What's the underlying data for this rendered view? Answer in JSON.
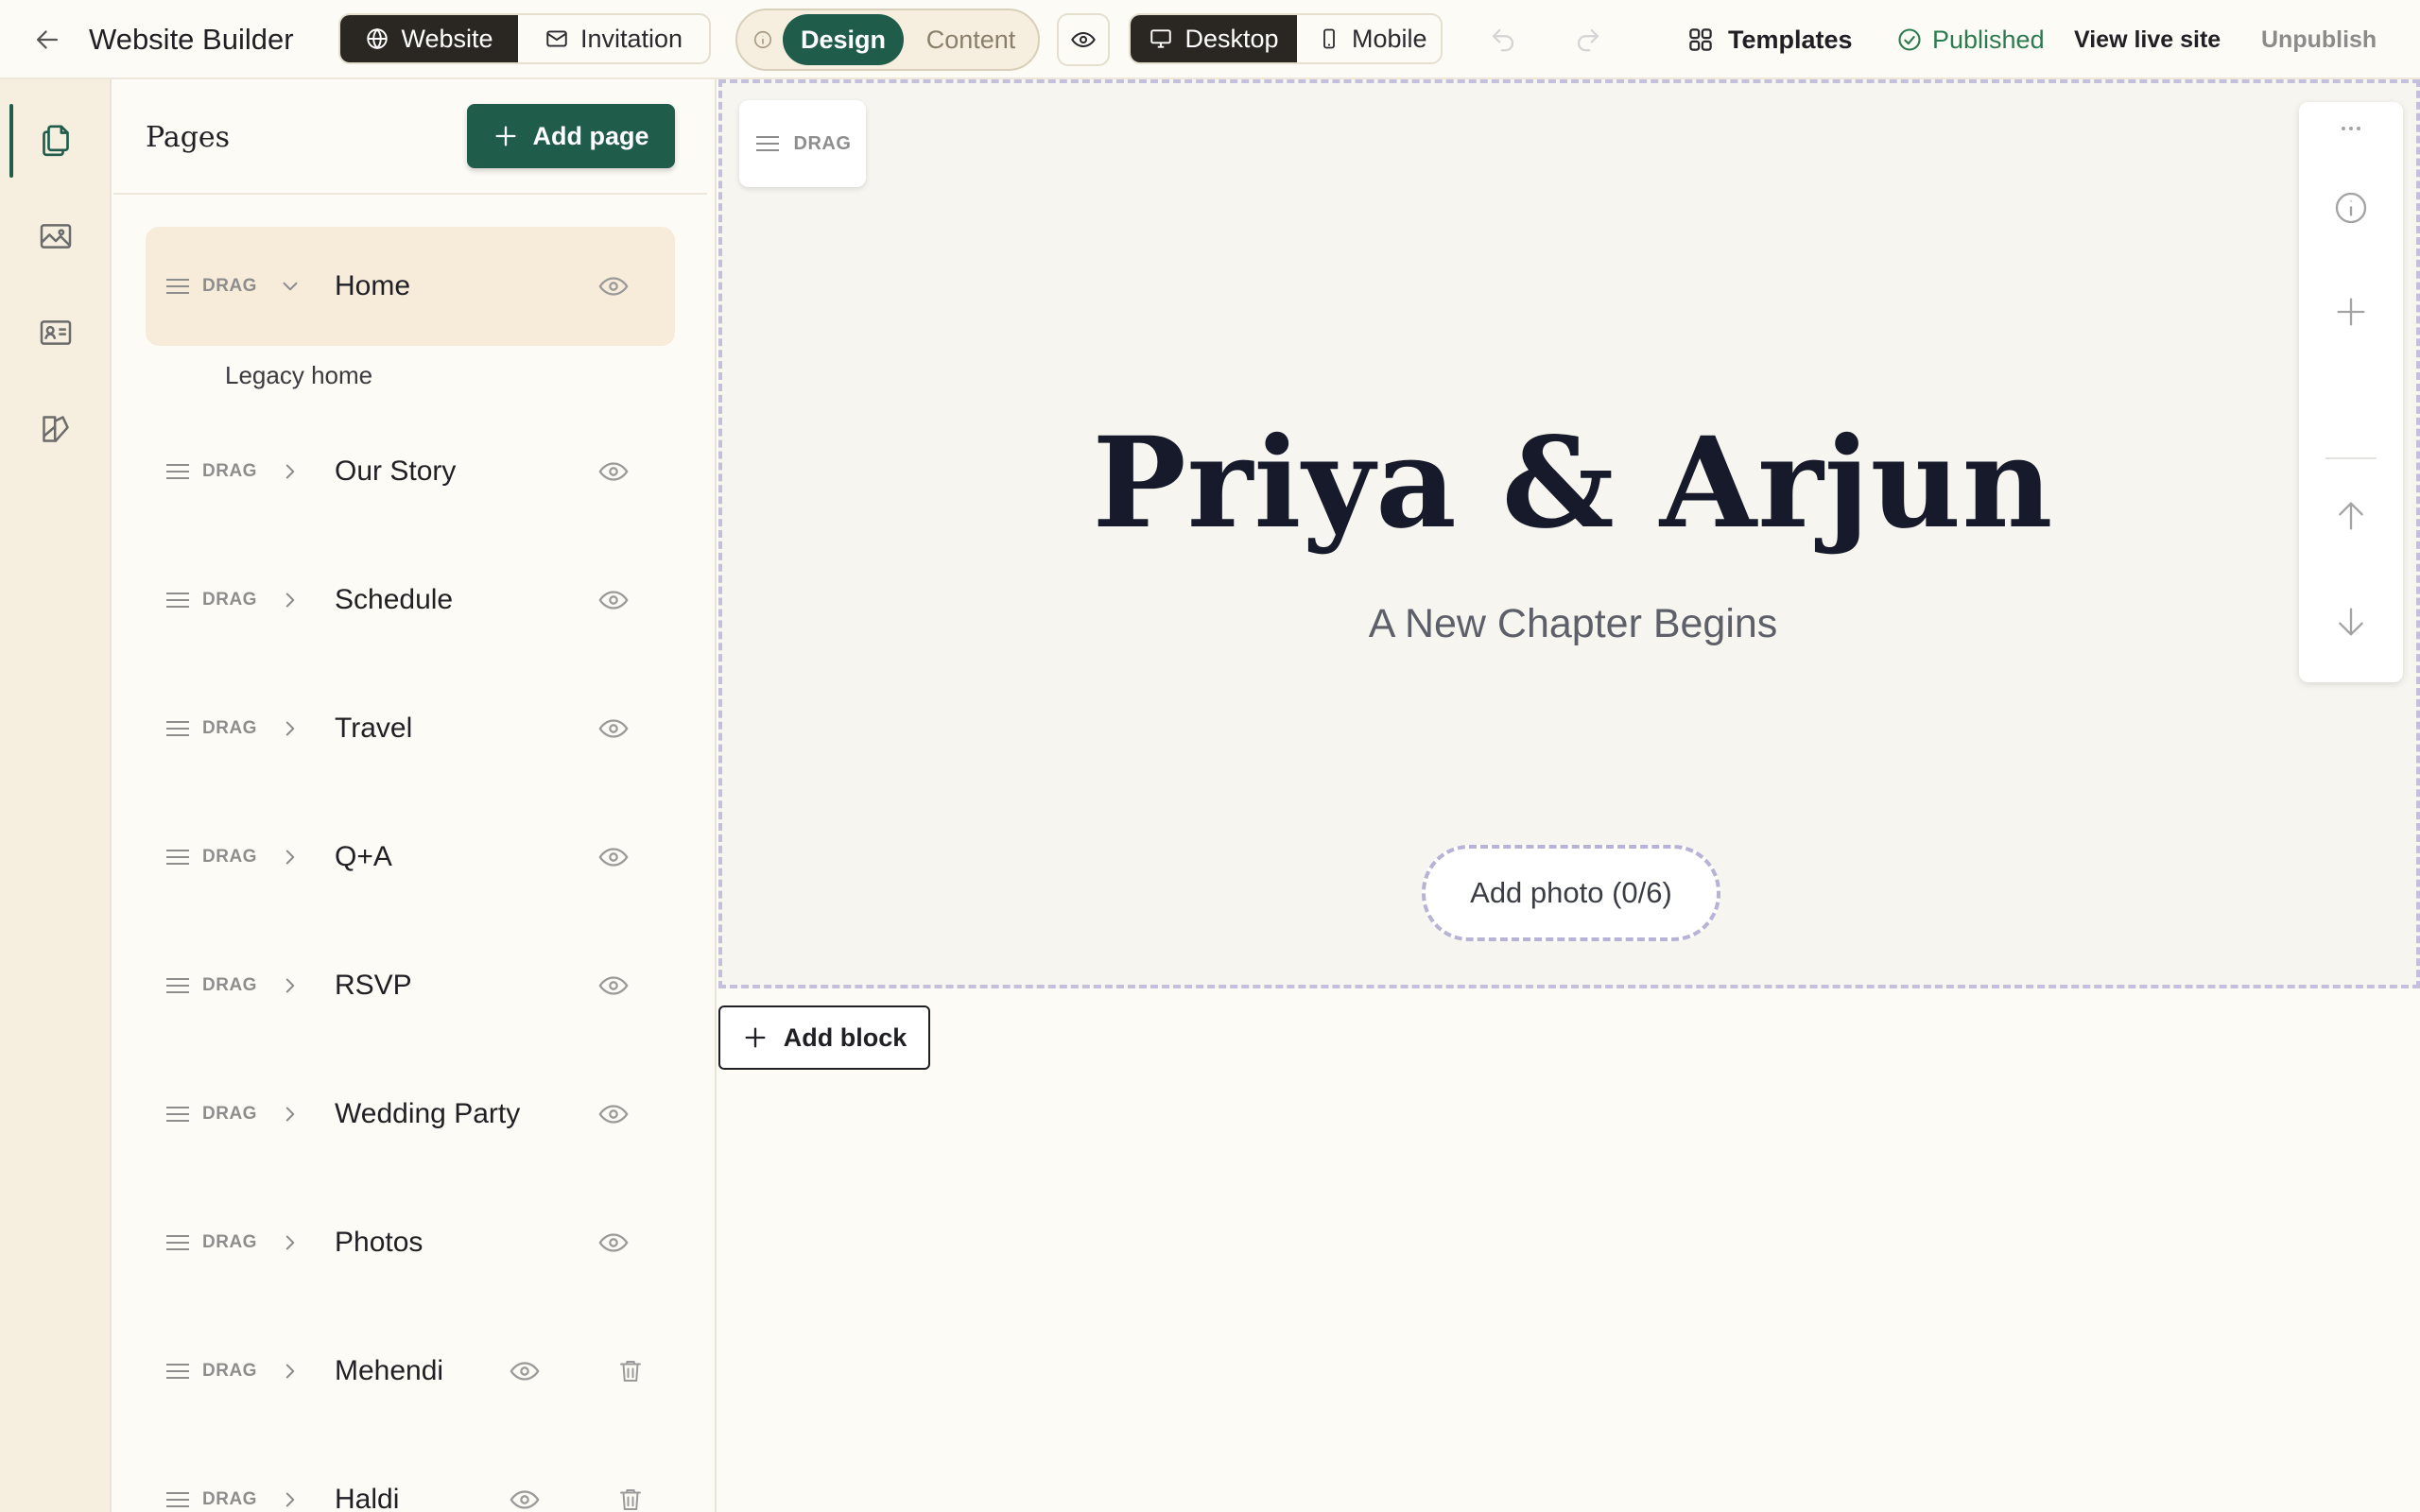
{
  "header": {
    "title": "Website Builder",
    "tabs": [
      {
        "label": "Website",
        "icon": "globe-icon",
        "active": true
      },
      {
        "label": "Invitation",
        "icon": "mail-icon",
        "active": false
      }
    ],
    "mode": {
      "options": [
        {
          "label": "Design",
          "active": true
        },
        {
          "label": "Content",
          "active": false
        }
      ]
    },
    "device": {
      "options": [
        {
          "label": "Desktop",
          "icon": "desktop-icon",
          "active": true
        },
        {
          "label": "Mobile",
          "icon": "mobile-icon",
          "active": false
        }
      ]
    },
    "templates_label": "Templates",
    "status_label": "Published",
    "live_site_label": "View live site",
    "unpublish_label": "Unpublish"
  },
  "rail": {
    "items": [
      {
        "icon": "pages-icon",
        "active": true
      },
      {
        "icon": "image-icon",
        "active": false
      },
      {
        "icon": "contact-card-icon",
        "active": false
      },
      {
        "icon": "theme-icon",
        "active": false
      }
    ]
  },
  "pages_panel": {
    "title": "Pages",
    "add_label": "Add page",
    "drag_label": "DRAG",
    "legacy_label": "Legacy home",
    "pages": [
      {
        "name": "Home",
        "expanded": true,
        "selected": true,
        "deletable": false
      },
      {
        "name": "Our Story",
        "expanded": false,
        "selected": false,
        "deletable": false
      },
      {
        "name": "Schedule",
        "expanded": false,
        "selected": false,
        "deletable": false
      },
      {
        "name": "Travel",
        "expanded": false,
        "selected": false,
        "deletable": false
      },
      {
        "name": "Q+A",
        "expanded": false,
        "selected": false,
        "deletable": false
      },
      {
        "name": "RSVP",
        "expanded": false,
        "selected": false,
        "deletable": false
      },
      {
        "name": "Wedding Party",
        "expanded": false,
        "selected": false,
        "deletable": false
      },
      {
        "name": "Photos",
        "expanded": false,
        "selected": false,
        "deletable": false
      },
      {
        "name": "Mehendi",
        "expanded": false,
        "selected": false,
        "deletable": true
      },
      {
        "name": "Haldi",
        "expanded": false,
        "selected": false,
        "deletable": true
      }
    ]
  },
  "canvas": {
    "drag_label": "DRAG",
    "hero": {
      "title": "Priya & Arjun",
      "subtitle": "A New Chapter Begins",
      "add_photo_label": "Add photo (0/6)"
    },
    "add_block_label": "Add block"
  },
  "colors": {
    "primary": "#1f5c4a",
    "dark": "#2a2621",
    "published": "#2c7a4f",
    "background": "#fdfbf5",
    "rail": "#f6efdf",
    "selected_row": "#f7ecda"
  }
}
